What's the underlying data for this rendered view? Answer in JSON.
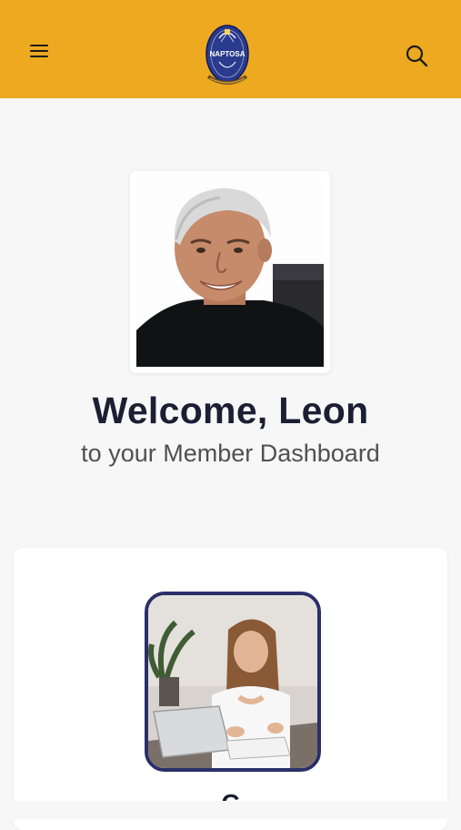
{
  "header": {
    "background_color": "#eda91f",
    "menu_icon": "hamburger-menu-icon",
    "logo_text": "NAPTOSA",
    "search_icon": "search-icon"
  },
  "profile": {
    "photo_alt": "Leon profile photo"
  },
  "welcome": {
    "title": "Welcome, Leon",
    "subtitle": "to your Member Dashboard"
  },
  "card": {
    "image_alt": "Woman working on laptop",
    "title_partial": "C"
  },
  "colors": {
    "accent": "#eda91f",
    "heading": "#1c1f33",
    "card_border": "#2b2f69"
  }
}
